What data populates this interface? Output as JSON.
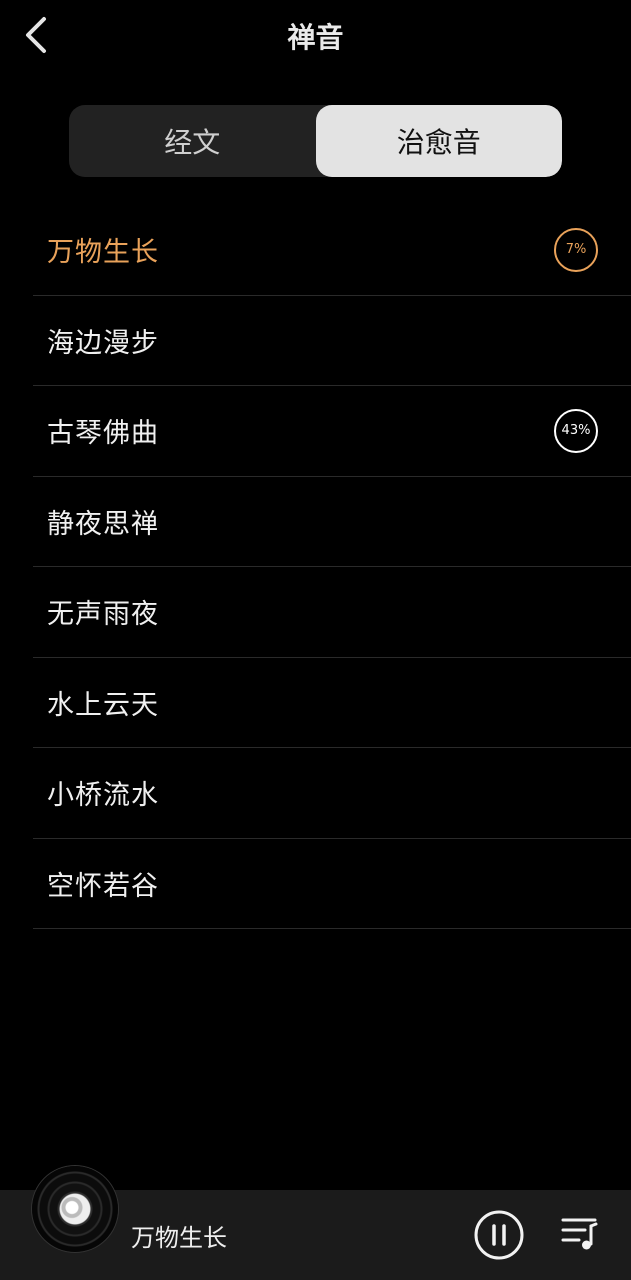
{
  "header": {
    "title": "禅音",
    "back_icon": "chevron-left-icon"
  },
  "tabs": [
    {
      "label": "经文",
      "selected": false
    },
    {
      "label": "治愈音",
      "selected": true
    }
  ],
  "tracks": [
    {
      "name": "万物生长",
      "progress": "7%",
      "current": true
    },
    {
      "name": "海边漫步",
      "progress": null,
      "current": false
    },
    {
      "name": "古琴佛曲",
      "progress": "43%",
      "current": false
    },
    {
      "name": "静夜思禅",
      "progress": null,
      "current": false
    },
    {
      "name": "无声雨夜",
      "progress": null,
      "current": false
    },
    {
      "name": "水上云天",
      "progress": null,
      "current": false
    },
    {
      "name": "小桥流水",
      "progress": null,
      "current": false
    },
    {
      "name": "空怀若谷",
      "progress": null,
      "current": false
    }
  ],
  "player": {
    "now_playing": "万物生长",
    "state": "playing",
    "pause_icon": "pause-icon",
    "playlist_icon": "playlist-icon"
  },
  "colors": {
    "accent": "#e9a25a",
    "background": "#000000",
    "tab_active_bg": "#e3e3e3",
    "tab_bg": "#222222",
    "player_bg": "#1b1b1b"
  }
}
